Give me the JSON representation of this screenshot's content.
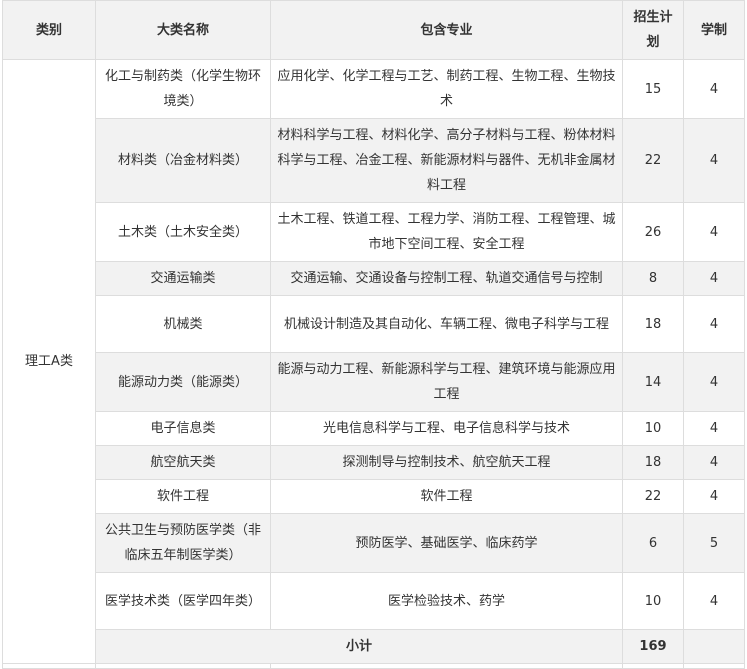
{
  "headers": [
    "类别",
    "大类名称",
    "包含专业",
    "招生计划",
    "学制"
  ],
  "category": "理工A类",
  "rows": [
    {
      "name": "化工与制药类（化学生物环境类）",
      "majors": "应用化学、化学工程与工艺、制药工程、生物工程、生物技术",
      "plan": "15",
      "years": "4"
    },
    {
      "name": "材料类（冶金材料类）",
      "majors": "材料科学与工程、材料化学、高分子材料与工程、粉体材料科学与工程、冶金工程、新能源材料与器件、无机非金属材料工程",
      "plan": "22",
      "years": "4"
    },
    {
      "name": "土木类（土木安全类）",
      "majors": "土木工程、铁道工程、工程力学、消防工程、工程管理、城市地下空间工程、安全工程",
      "plan": "26",
      "years": "4"
    },
    {
      "name": "交通运输类",
      "majors": "交通运输、交通设备与控制工程、轨道交通信号与控制",
      "plan": "8",
      "years": "4"
    },
    {
      "name": "机械类",
      "majors": "机械设计制造及其自动化、车辆工程、微电子科学与工程",
      "plan": "18",
      "years": "4"
    },
    {
      "name": "能源动力类（能源类）",
      "majors": "能源与动力工程、新能源科学与工程、建筑环境与能源应用工程",
      "plan": "14",
      "years": "4"
    },
    {
      "name": "电子信息类",
      "majors": "光电信息科学与工程、电子信息科学与技术",
      "plan": "10",
      "years": "4"
    },
    {
      "name": "航空航天类",
      "majors": "探测制导与控制技术、航空航天工程",
      "plan": "18",
      "years": "4"
    },
    {
      "name": "软件工程",
      "majors": "软件工程",
      "plan": "22",
      "years": "4"
    },
    {
      "name": "公共卫生与预防医学类（非临床五年制医学类）",
      "majors": "预防医学、基础医学、临床药学",
      "plan": "6",
      "years": "5"
    },
    {
      "name": "医学技术类（医学四年类）",
      "majors": "医学检验技术、药学",
      "plan": "10",
      "years": "4"
    }
  ],
  "subtotal": {
    "label": "小计",
    "plan": "169",
    "years": ""
  }
}
